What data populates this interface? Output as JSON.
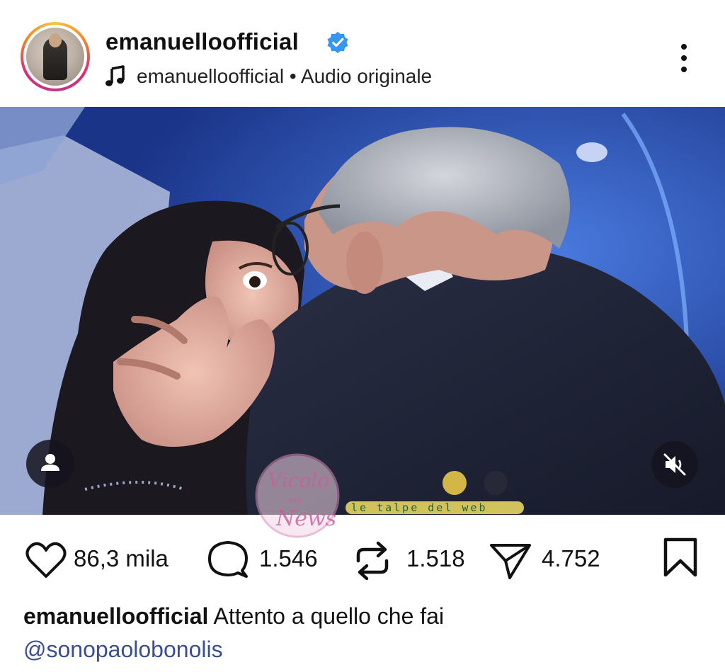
{
  "post": {
    "username": "emanuelloofficial",
    "verified": true,
    "audio": {
      "owner": "emanuelloofficial",
      "separator": "•",
      "label": "Audio originale"
    }
  },
  "media": {
    "watermark_text": "le talpe del web",
    "watermark_logo_text": "Vicolo delle News"
  },
  "actions": {
    "likes": "86,3 mila",
    "comments": "1.546",
    "reposts": "1.518",
    "shares": "4.752"
  },
  "caption": {
    "username": "emanuelloofficial",
    "text": "Attento a quello che fai",
    "mention": "@sonopaolobonolis"
  },
  "icons": {
    "more": "more-vertical-icon",
    "music": "music-note-icon",
    "verified": "verified-badge-icon",
    "user_tag": "user-tag-icon",
    "mute": "speaker-muted-icon",
    "like": "heart-icon",
    "comment": "comment-bubble-icon",
    "repost": "repost-icon",
    "share": "send-icon",
    "save": "bookmark-icon"
  },
  "colors": {
    "verified": "#3797f0",
    "mention": "#3b4f8e",
    "ring_start": "#f9c33b",
    "ring_end": "#c13584"
  }
}
